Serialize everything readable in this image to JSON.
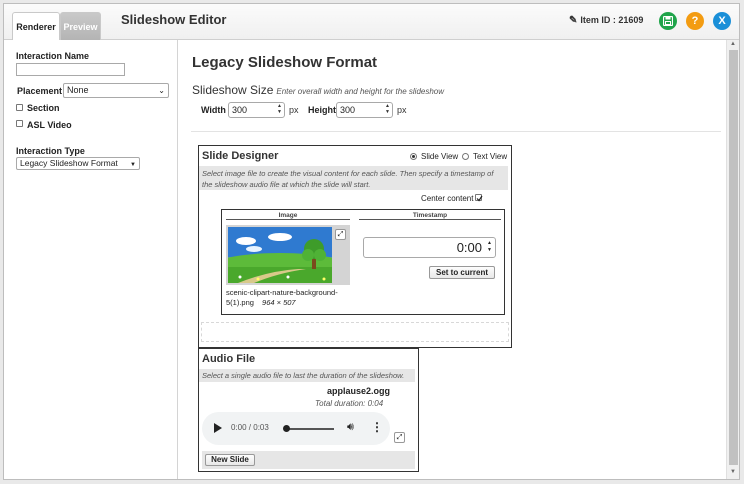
{
  "tabs": {
    "renderer": "Renderer",
    "preview": "Preview"
  },
  "app_title": "Slideshow Editor",
  "item_id": "Item ID : 21609",
  "header_buttons": {
    "save_icon": "floppy-disk-icon",
    "help": "?",
    "close": "X"
  },
  "sidebar": {
    "interaction_name_label": "Interaction Name",
    "interaction_name_value": "",
    "placement_label": "Placement",
    "placement_value": "None",
    "section_label": "Section",
    "asl_video_label": "ASL Video",
    "interaction_type_label": "Interaction Type",
    "interaction_type_value": "Legacy Slideshow Format"
  },
  "main": {
    "title": "Legacy Slideshow Format",
    "size_title": "Slideshow Size",
    "size_hint": "Enter overall width and height for the slideshow",
    "width_label": "Width",
    "width_value": "300",
    "height_label": "Height",
    "height_value": "300",
    "unit": "px"
  },
  "slide_designer": {
    "title": "Slide Designer",
    "slide_view": "Slide View",
    "text_view": "Text View",
    "hint": "Select image file to create the visual content for each slide. Then specify a timestamp of the slideshow audio file at which the slide will start.",
    "center_content": "Center content",
    "col_image": "Image",
    "col_timestamp": "Timestamp",
    "image_filename": "scenic-clipart-nature-background-5(1).png",
    "image_dims": "964 × 507",
    "timestamp_value": "0:00",
    "set_to_current": "Set to current"
  },
  "audio": {
    "title": "Audio File",
    "hint": "Select a single audio file to last the duration of the slideshow.",
    "filename": "applause2.ogg",
    "duration": "Total duration: 0:04",
    "player_time": "0:00 / 0:03",
    "new_slide": "New Slide"
  }
}
